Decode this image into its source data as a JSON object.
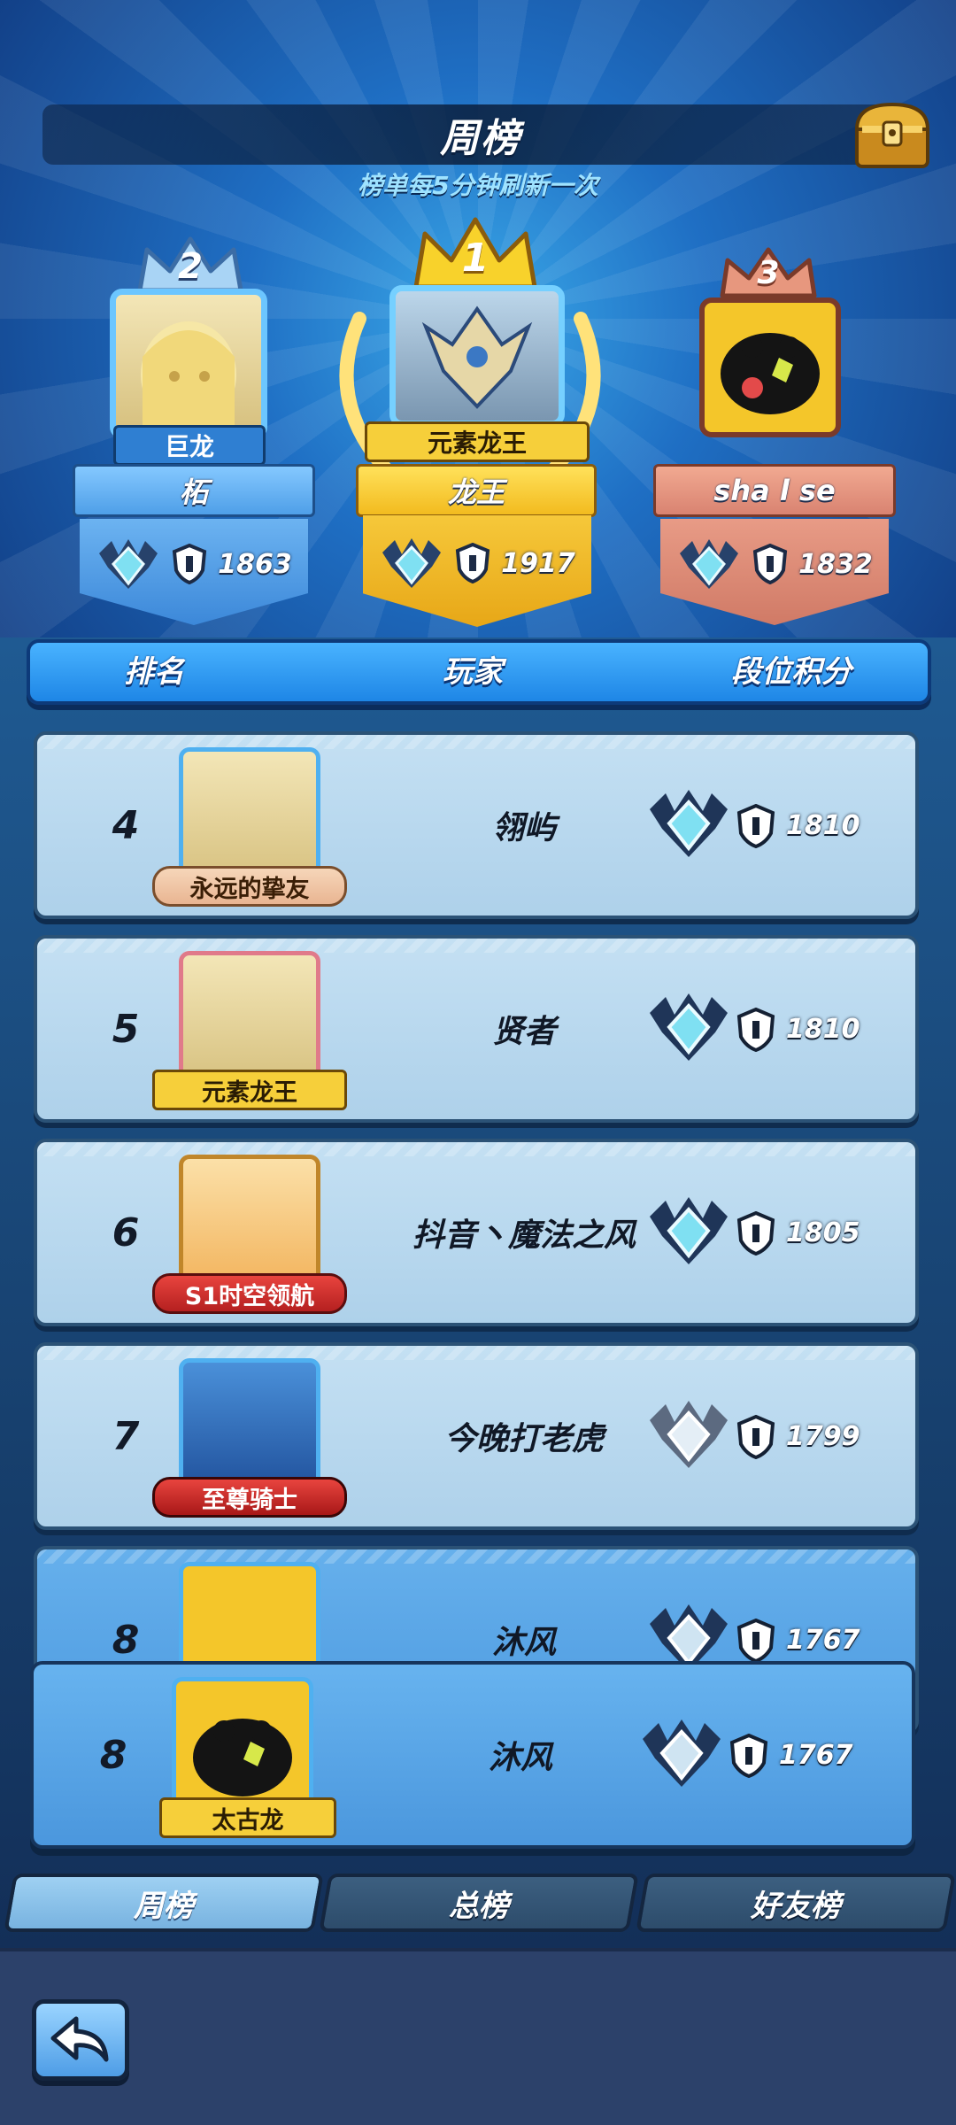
{
  "header": {
    "title": "周榜",
    "subtitle": "榜单每5分钟刷新一次"
  },
  "podium": [
    {
      "rank": "2",
      "title": "巨龙",
      "name": "柘",
      "score": "1863",
      "crown_color": "#a9d4f5",
      "plate_color": "#5aa8e8"
    },
    {
      "rank": "1",
      "title": "元素龙王",
      "name": "龙王",
      "score": "1917",
      "crown_color": "#f8d22b",
      "plate_color": "#f2c02e"
    },
    {
      "rank": "3",
      "title": "",
      "name": "sha l se",
      "score": "1832",
      "crown_color": "#e7977e",
      "plate_color": "#de8a76"
    }
  ],
  "columns": {
    "rank": "排名",
    "player": "玩家",
    "score": "段位积分"
  },
  "rows": [
    {
      "rank": "4",
      "title": "永远的挚友",
      "name": "翎屿",
      "score": "1810"
    },
    {
      "rank": "5",
      "title": "元素龙王",
      "name": "贤者",
      "score": "1810"
    },
    {
      "rank": "6",
      "title": "S1时空领航",
      "name": "抖音丶魔法之风",
      "score": "1805"
    },
    {
      "rank": "7",
      "title": "至尊骑士",
      "name": "今晚打老虎",
      "score": "1799"
    },
    {
      "rank": "8",
      "title": "",
      "name": "沐风",
      "score": "1767"
    }
  ],
  "self_row": {
    "rank": "8",
    "title": "太古龙",
    "name": "沐风",
    "score": "1767"
  },
  "tabs": [
    {
      "label": "周榜",
      "active": true
    },
    {
      "label": "总榜",
      "active": false
    },
    {
      "label": "好友榜",
      "active": false
    }
  ],
  "icons": {
    "chest": "treasure-chest-icon",
    "back": "back-arrow-icon",
    "rank_emblem": "dragon-rank-emblem-icon",
    "shield": "shield-icon"
  }
}
